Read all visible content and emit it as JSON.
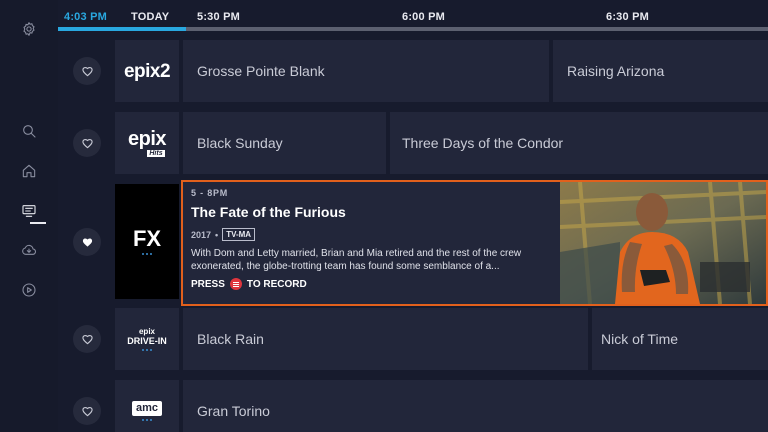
{
  "timebar": {
    "now": "4:03 PM",
    "today": "TODAY",
    "slots": [
      "5:30 PM",
      "6:00 PM",
      "6:30 PM"
    ],
    "progress": 0.18
  },
  "sidebar": {
    "items": [
      {
        "icon": "settings-icon"
      },
      {
        "icon": "search-icon"
      },
      {
        "icon": "home-icon"
      },
      {
        "icon": "guide-icon",
        "active": true
      },
      {
        "icon": "cloud-dvr-icon"
      },
      {
        "icon": "play-icon"
      }
    ]
  },
  "channels": [
    {
      "logo": "epix2",
      "favorite": false,
      "programs": [
        "Grosse Pointe Blank",
        "Raising Arizona"
      ]
    },
    {
      "logo": "epix",
      "logo_sub": "Hits",
      "favorite": false,
      "programs": [
        "Black Sunday",
        "Three Days of the Condor"
      ]
    },
    {
      "logo": "FX",
      "favorite": true,
      "expanded": {
        "time": "5 - 8PM",
        "title": "The Fate of the Furious",
        "year": "2017",
        "separator": "•",
        "rating": "TV-MA",
        "description": "With Dom and Letty married, Brian and Mia retired and the rest of the crew exonerated, the globe-trotting team has found some semblance of a...",
        "record_prefix": "PRESS",
        "record_suffix": "TO RECORD"
      }
    },
    {
      "logo": "epix",
      "logo_sub": "DRIVE-IN",
      "favorite": false,
      "programs": [
        "Black Rain",
        "Nick of Time"
      ]
    },
    {
      "logo": "amc",
      "favorite": false,
      "programs": [
        "Gran Torino"
      ]
    }
  ],
  "colors": {
    "accent": "#29a8e0",
    "focus": "#e2601c",
    "record": "#e0353d",
    "background": "#171b2d",
    "tile": "#22263a"
  }
}
